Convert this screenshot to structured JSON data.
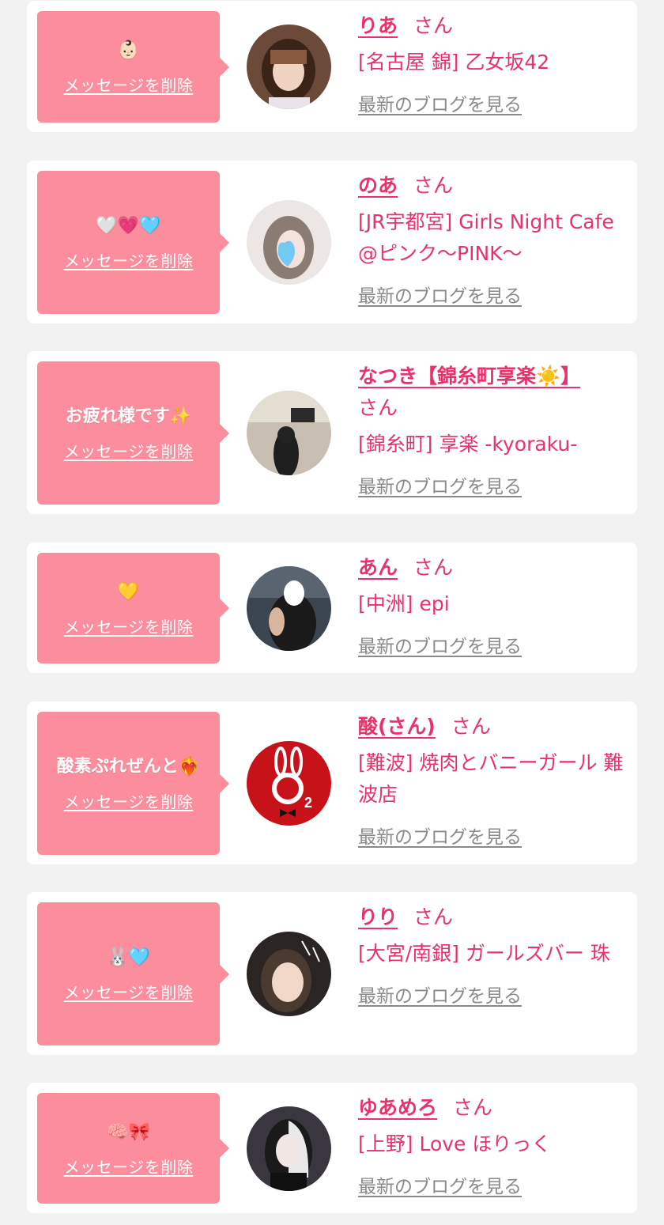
{
  "labels": {
    "delete": "メッセージを削除",
    "latest_blog": "最新のブログを見る",
    "honorific": "さん"
  },
  "colors": {
    "page_bg": "#f2f2f2",
    "bubble": "#fc8d9d",
    "accent": "#e8326a",
    "link_gray": "#8a8a8a"
  },
  "items": [
    {
      "message": "👶🏻",
      "name": "りあ",
      "shop": "[名古屋 錦] 乙女坂42"
    },
    {
      "message": "🤍💗🩵",
      "name": "のあ",
      "shop": "[JR宇都宮] Girls Night Cafe @ピンク～PINK～"
    },
    {
      "message": "お疲れ様です✨",
      "name": "なつき【錦糸町享楽☀️】",
      "shop": "[錦糸町] 享楽 -kyoraku-"
    },
    {
      "message": "💛",
      "name": "あん",
      "shop": "[中洲] epi"
    },
    {
      "message": "酸素ぷれぜんと❤️‍🔥",
      "name": "酸(さん)",
      "shop": "[難波] 焼肉とバニーガール 難波店"
    },
    {
      "message": "🐰🩵",
      "name": "りり",
      "shop": "[大宮/南銀] ガールズバー 珠"
    },
    {
      "message": "🧠🎀",
      "name": "ゆあめろ",
      "shop": "[上野] Love ほりっく"
    }
  ]
}
